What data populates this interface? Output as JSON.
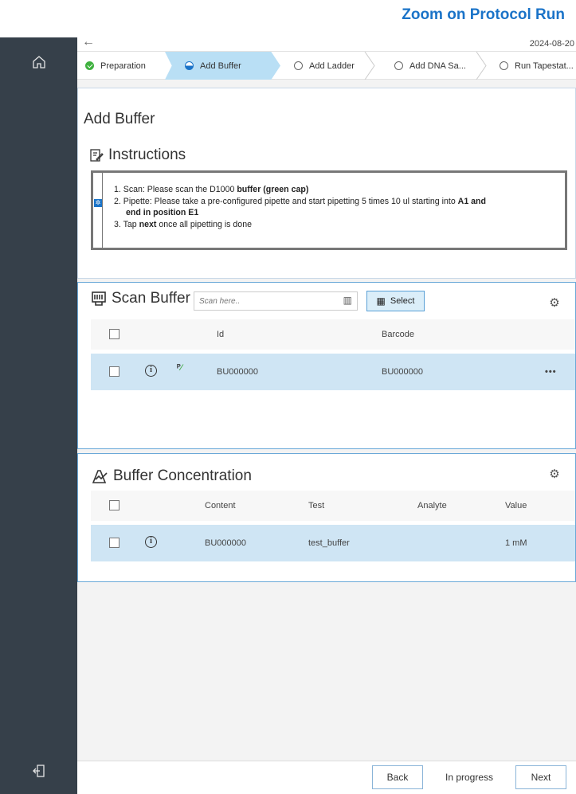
{
  "banner": {
    "title": "Zoom on Protocol Run"
  },
  "topbar": {
    "date": "2024-08-20"
  },
  "rail": {
    "home_icon": "home-icon",
    "logout_icon": "logout-icon"
  },
  "stepper": {
    "steps": [
      {
        "label": "Preparation",
        "state": "done"
      },
      {
        "label": "Add Buffer",
        "state": "active"
      },
      {
        "label": "Add Ladder",
        "state": "pending"
      },
      {
        "label": "Add DNA Sa...",
        "state": "pending"
      },
      {
        "label": "Run Tapestat...",
        "state": "pending"
      }
    ]
  },
  "page": {
    "title": "Add Buffer"
  },
  "instructions": {
    "title": "Instructions",
    "line1_pre": "1. Scan: Please scan the D1000 ",
    "line1_bold": "buffer (green cap)",
    "line2_pre": "2. Pipette: Please take a pre-configured pipette and start pipetting 5 times 10 ul starting into ",
    "line2_bold": "A1 and",
    "line2b_bold": "end in position E1",
    "line3_pre": "3. Tap ",
    "line3_bold": "next",
    "line3_post": " once all pipetting is done"
  },
  "scan_buffer": {
    "title": "Scan Buffer",
    "placeholder": "Scan here..",
    "select_label": "Select",
    "columns": [
      "Id",
      "Barcode"
    ],
    "rows": [
      {
        "id": "BU000000",
        "barcode": "BU000000"
      }
    ],
    "more": "•••"
  },
  "concentration": {
    "title": "Buffer Concentration",
    "columns": [
      "Content",
      "Test",
      "Analyte",
      "Value"
    ],
    "rows": [
      {
        "content": "BU000000",
        "test": "test_buffer",
        "analyte": "",
        "value": "1 mM"
      }
    ]
  },
  "bottom": {
    "back_label": "Back",
    "status": "In progress",
    "next_label": "Next"
  },
  "colors": {
    "accent": "#1a73c8",
    "rail": "#36404a",
    "active_step": "#b9dff5",
    "row_selected": "#cfe5f4",
    "done": "#3fb13f"
  }
}
